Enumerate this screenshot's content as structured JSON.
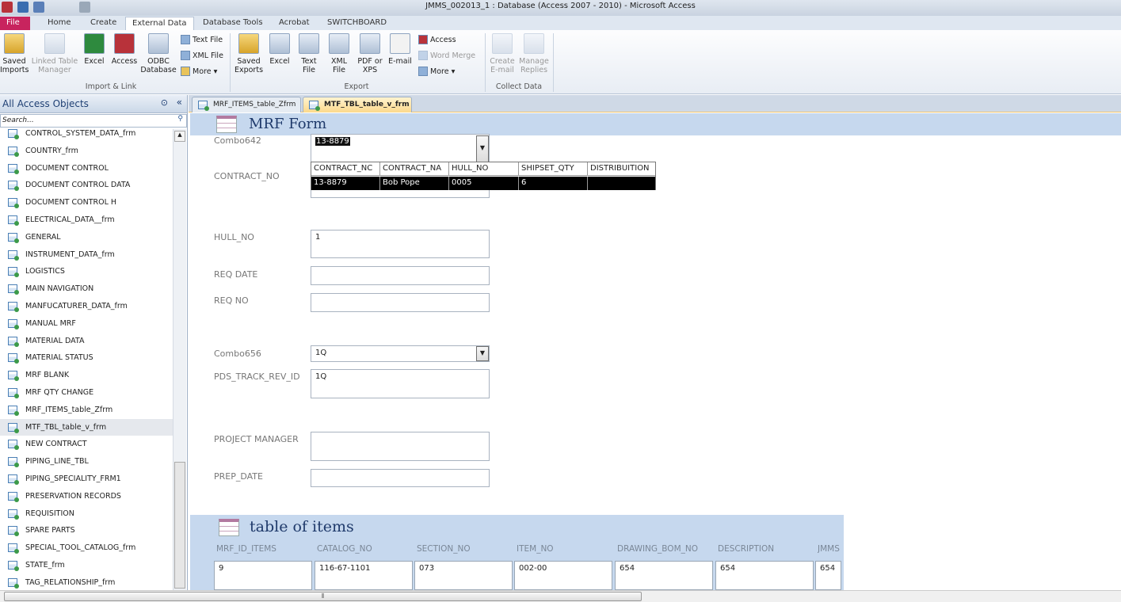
{
  "window": {
    "title": "JMMS_002013_1 : Database (Access 2007 - 2010)  -  Microsoft Access"
  },
  "ribbon_tabs": [
    "File",
    "Home",
    "Create",
    "External Data",
    "Database Tools",
    "Acrobat",
    "SWITCHBOARD"
  ],
  "ribbon": {
    "import": {
      "saved_imports": "Saved Imports",
      "linked_table_manager": "Linked Table Manager",
      "excel": "Excel",
      "access": "Access",
      "odbc": "ODBC Database",
      "text_file": "Text File",
      "xml_file": "XML File",
      "more": "More ▾",
      "group": "Import & Link"
    },
    "export": {
      "saved_exports": "Saved Exports",
      "excel": "Excel",
      "text_file": "Text File",
      "xml_file": "XML File",
      "pdf": "PDF or XPS",
      "email": "E-mail",
      "access": "Access",
      "word_merge": "Word Merge",
      "more": "More ▾",
      "group": "Export"
    },
    "collect": {
      "create_email": "Create E-mail",
      "manage_replies": "Manage Replies",
      "group": "Collect Data"
    }
  },
  "nav": {
    "title": "All Access Objects",
    "search_placeholder": "Search...",
    "selected": "MTF_TBL_table_v_frm",
    "items": [
      "CONTROL_SYSTEM_DATA_frm",
      "COUNTRY_frm",
      "DOCUMENT CONTROL",
      "DOCUMENT CONTROL DATA",
      "DOCUMENT CONTROL H",
      "ELECTRICAL_DATA__frm",
      "GENERAL",
      "INSTRUMENT_DATA_frm",
      "LOGISTICS",
      "MAIN NAVIGATION",
      "MANFUCATURER_DATA_frm",
      "MANUAL MRF",
      "MATERIAL DATA",
      "MATERIAL STATUS",
      "MRF BLANK",
      "MRF QTY CHANGE",
      "MRF_ITEMS_table_Zfrm",
      "MTF_TBL_table_v_frm",
      "NEW CONTRACT",
      "PIPING_LINE_TBL",
      "PIPING_SPECIALITY_FRM1",
      "PRESERVATION RECORDS",
      "REQUISITION",
      "SPARE PARTS",
      "SPECIAL_TOOL_CATALOG_frm",
      "STATE_frm",
      "TAG_RELATIONSHIP_frm"
    ]
  },
  "doc_tabs": [
    "MRF_ITEMS_table_Zfrm",
    "MTF_TBL_table_v_frm"
  ],
  "form": {
    "title": "MRF Form",
    "fields": {
      "combo642": {
        "label": "Combo642",
        "value": "13-8879"
      },
      "contract_no": {
        "label": "CONTRACT_NO",
        "value": ""
      },
      "hull_no": {
        "label": "HULL_NO",
        "value": "1"
      },
      "req_date": {
        "label": "REQ DATE",
        "value": ""
      },
      "req_no": {
        "label": "REQ NO",
        "value": ""
      },
      "combo656": {
        "label": "Combo656",
        "value": "1Q"
      },
      "pds": {
        "label": "PDS_TRACK_REV_ID",
        "value": "1Q"
      },
      "pm": {
        "label": "PROJECT MANAGER",
        "value": ""
      },
      "prep_date": {
        "label": "PREP_DATE",
        "value": ""
      }
    },
    "dropdown": {
      "headers": [
        "CONTRACT_NC",
        "CONTRACT_NA",
        "HULL_NO",
        "SHIPSET_QTY",
        "DISTRIBUITION"
      ],
      "row": [
        "13-8879",
        "Bob Pope",
        "0005",
        "6",
        ""
      ]
    }
  },
  "subform": {
    "title": "table of items",
    "headers": [
      "MRF_ID_ITEMS",
      "CATALOG_NO",
      "SECTION_NO",
      "ITEM_NO",
      "DRAWING_BOM_NO",
      "DESCRIPTION",
      "JMMS"
    ],
    "row": [
      "9",
      "116-67-1101",
      "073",
      "002-00",
      "654",
      "654",
      "654"
    ]
  }
}
